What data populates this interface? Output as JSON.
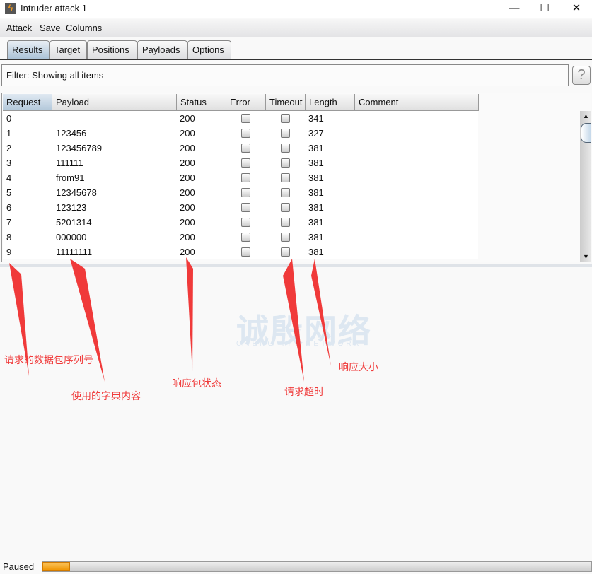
{
  "window": {
    "title": "Intruder attack 1",
    "minimize": "—",
    "maximize": "☐",
    "close": "✕"
  },
  "menu": [
    "Attack",
    "Save",
    "Columns"
  ],
  "tabs": [
    {
      "label": "Results",
      "active": true
    },
    {
      "label": "Target"
    },
    {
      "label": "Positions"
    },
    {
      "label": "Payloads"
    },
    {
      "label": "Options"
    }
  ],
  "filter": {
    "text": "Filter: Showing all items",
    "help": "?"
  },
  "table": {
    "columns": [
      "Request ▲",
      "Payload",
      "Status",
      "Error",
      "Timeout",
      "Length",
      "Comment"
    ],
    "rows": [
      {
        "request": "0",
        "payload": "",
        "status": "200",
        "error": false,
        "timeout": false,
        "length": "341",
        "comment": ""
      },
      {
        "request": "1",
        "payload": "123456",
        "status": "200",
        "error": false,
        "timeout": false,
        "length": "327",
        "comment": ""
      },
      {
        "request": "2",
        "payload": "123456789",
        "status": "200",
        "error": false,
        "timeout": false,
        "length": "381",
        "comment": ""
      },
      {
        "request": "3",
        "payload": "111111",
        "status": "200",
        "error": false,
        "timeout": false,
        "length": "381",
        "comment": ""
      },
      {
        "request": "4",
        "payload": "from91",
        "status": "200",
        "error": false,
        "timeout": false,
        "length": "381",
        "comment": ""
      },
      {
        "request": "5",
        "payload": "12345678",
        "status": "200",
        "error": false,
        "timeout": false,
        "length": "381",
        "comment": ""
      },
      {
        "request": "6",
        "payload": "123123",
        "status": "200",
        "error": false,
        "timeout": false,
        "length": "381",
        "comment": ""
      },
      {
        "request": "7",
        "payload": "5201314",
        "status": "200",
        "error": false,
        "timeout": false,
        "length": "381",
        "comment": ""
      },
      {
        "request": "8",
        "payload": "000000",
        "status": "200",
        "error": false,
        "timeout": false,
        "length": "381",
        "comment": ""
      },
      {
        "request": "9",
        "payload": "11111111",
        "status": "200",
        "error": false,
        "timeout": false,
        "length": "381",
        "comment": ""
      }
    ]
  },
  "annotations": {
    "request": "请求的数据包序列号",
    "payload": "使用的字典内容",
    "status": "响应包状态",
    "timeout": "请求超时",
    "length": "响应大小",
    "color": "#f03a3a"
  },
  "watermark": {
    "text": "诚殷网络",
    "sub": "CHENG YIN NETWORK"
  },
  "statusbar": {
    "text": "Paused",
    "progress_percent": 5
  }
}
